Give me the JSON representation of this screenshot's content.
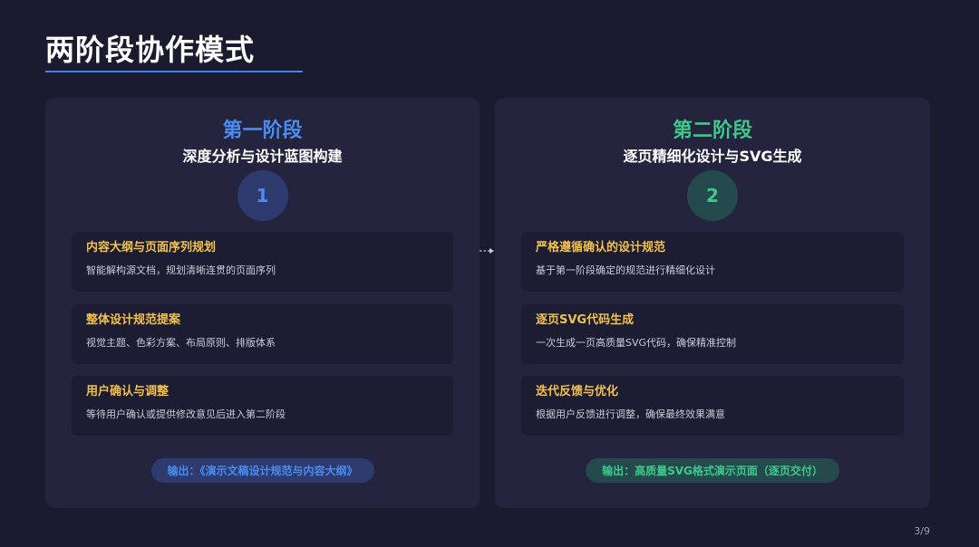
{
  "page": {
    "title": "两阶段协作模式",
    "page_number": "3/9",
    "colors": {
      "background": "#1b1b2f",
      "panel": "#24243f",
      "accent_blue": "#4a8cf0",
      "accent_green": "#3ec98a",
      "step_title": "#f2c14e",
      "underline": "#3b82f6"
    }
  },
  "phase1": {
    "name": "第一阶段",
    "subtitle": "深度分析与设计蓝图构建",
    "number": "1",
    "steps": [
      {
        "title": "内容大纲与页面序列规划",
        "desc": "智能解构源文档，规划清晰连贯的页面序列"
      },
      {
        "title": "整体设计规范提案",
        "desc": "视觉主题、色彩方案、布局原则、排版体系"
      },
      {
        "title": "用户确认与调整",
        "desc": "等待用户确认或提供修改意见后进入第二阶段"
      }
    ],
    "output": "输出：《演示文稿设计规范与内容大纲》"
  },
  "phase2": {
    "name": "第二阶段",
    "subtitle": "逐页精细化设计与SVG生成",
    "number": "2",
    "steps": [
      {
        "title": "严格遵循确认的设计规范",
        "desc": "基于第一阶段确定的规范进行精细化设计"
      },
      {
        "title": "逐页SVG代码生成",
        "desc": "一次生成一页高质量SVG代码，确保精准控制"
      },
      {
        "title": "迭代反馈与优化",
        "desc": "根据用户反馈进行调整，确保最终效果满意"
      }
    ],
    "output": "输出：高质量SVG格式演示页面（逐页交付）"
  },
  "connector_icon": "dashed-arrow-right-icon"
}
